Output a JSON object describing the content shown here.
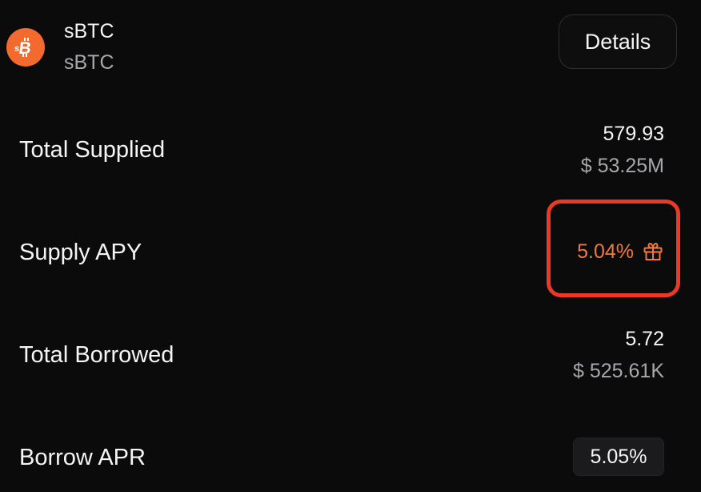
{
  "asset": {
    "name": "sBTC",
    "symbol": "sBTC",
    "logo_icon": "sbtc-logo-icon",
    "details_label": "Details"
  },
  "stats": {
    "total_supplied": {
      "label": "Total Supplied",
      "amount": "579.93",
      "usd": "$ 53.25M"
    },
    "supply_apy": {
      "label": "Supply APY",
      "value": "5.04%",
      "icon": "gift-icon"
    },
    "total_borrowed": {
      "label": "Total Borrowed",
      "amount": "5.72",
      "usd": "$ 525.61K"
    },
    "borrow_apr": {
      "label": "Borrow APR",
      "value": "5.05%"
    }
  },
  "colors": {
    "background": "#0b0b0b",
    "accent_orange": "#f07a3c",
    "logo_orange": "#f26a2d",
    "highlight_red": "#ea3a26",
    "muted_text": "#a7a7ad"
  }
}
